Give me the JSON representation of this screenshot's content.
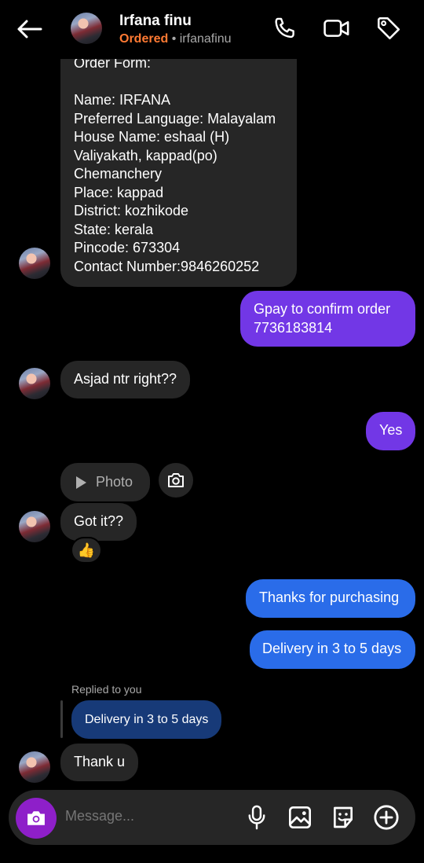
{
  "header": {
    "name": "Irfana finu",
    "status": "Ordered",
    "separator": " • ",
    "username": "irfanafinu"
  },
  "messages": {
    "order_form": "Order Form:\n\nName: IRFANA\nPreferred Language: Malayalam\nHouse Name: eshaal (H)\nValiyakath, kappad(po)\nChemanchery\nPlace: kappad\nDistrict: kozhikode\nState: kerala\nPincode: 673304\nContact Number:9846260252",
    "gpay": "Gpay to confirm order\n7736183814",
    "asjad": "Asjad ntr right??",
    "yes": "Yes",
    "photo": "Photo",
    "got_it": "Got it??",
    "reaction": "👍",
    "thanks": "Thanks for purchasing",
    "delivery": "Delivery in 3 to 5 days",
    "replied_label": "Replied to you",
    "reply_quote": "Delivery in 3 to 5 days",
    "thank_u": "Thank u"
  },
  "composer": {
    "placeholder": "Message..."
  },
  "colors": {
    "outgoing_purple": "#7237e6",
    "outgoing_blue": "#2a6ce9",
    "incoming": "#262626",
    "status_orange": "#ff7a33",
    "camera_button": "#8e1fc9"
  }
}
